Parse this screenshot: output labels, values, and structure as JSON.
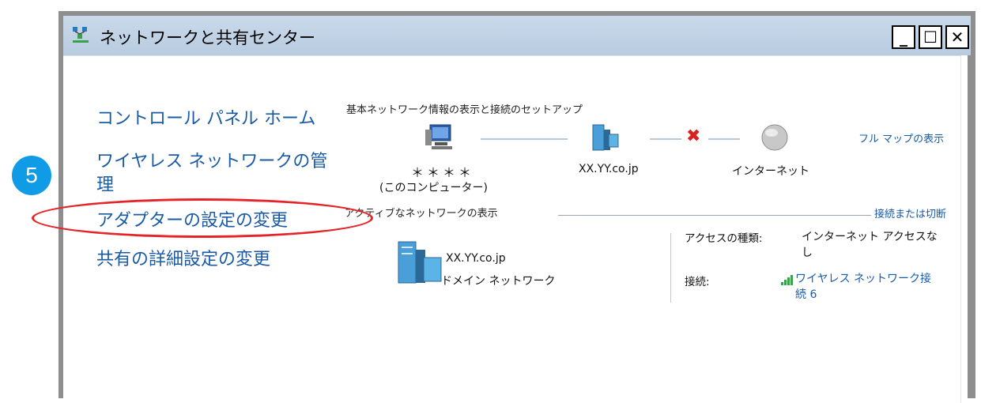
{
  "window": {
    "title": "ネットワークと共有センター",
    "min_glyph": "_",
    "max_glyph": "☐",
    "close_glyph": "✕"
  },
  "sidebar": {
    "items": [
      {
        "label": "コントロール パネル ホーム"
      },
      {
        "label": "ワイヤレス ネットワークの管\n理"
      },
      {
        "label": "アダプターの設定の変更"
      },
      {
        "label": "共有の詳細設定の変更"
      }
    ]
  },
  "annotation": {
    "step": "5",
    "highlight_color": "#e5242a",
    "badge_color": "#0f9be6"
  },
  "basic": {
    "heading": "基本ネットワーク情報の表示と接続のセットアップ",
    "full_map": "フル マップの表示",
    "nodes": {
      "computer_name": "＊＊＊＊",
      "computer_sub": "(このコンピューター)",
      "domain": "XX.YY.co.jp",
      "internet": "インターネット"
    }
  },
  "active": {
    "heading": "アクティブなネットワークの表示",
    "connect_link": "接続または切断",
    "network_name": "XX.YY.co.jp",
    "network_type": "ドメイン ネットワーク",
    "access_label": "アクセスの種類:",
    "access_value": "インターネット アクセスな\nし",
    "conn_label": "接続:",
    "conn_value": "ワイヤレス ネットワーク接\n続 6"
  }
}
